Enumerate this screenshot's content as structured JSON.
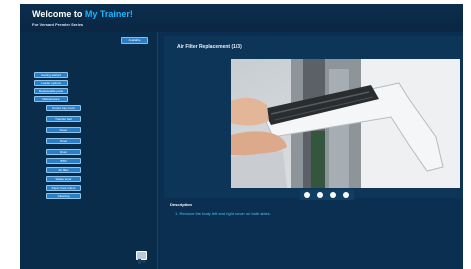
{
  "header": {
    "title_prefix": "Welcome to ",
    "title_brand": "My Trainer!",
    "subtitle": "For Versant Premier Series"
  },
  "sidebar": {
    "top_button": "Available",
    "items": [
      {
        "label": "Getting started"
      },
      {
        "label": "Loader options"
      },
      {
        "label": "Replaceable parts"
      },
      {
        "label": "Maintenance"
      }
    ],
    "subitems": [
      {
        "label": "Output tray cover"
      },
      {
        "label": "Transfer belt"
      },
      {
        "label": "Fuser"
      },
      {
        "label": "Toner"
      },
      {
        "label": "Drum"
      },
      {
        "label": "BTR"
      },
      {
        "label": "Air filter"
      },
      {
        "label": "Waste toner"
      },
      {
        "label": "Paper feed rollers"
      },
      {
        "label": "Cleaning"
      }
    ],
    "exit_icon": "exit-door-icon"
  },
  "viewer": {
    "title": "Air Filter Replacement (1/3)",
    "controls": [
      "first-icon",
      "previous-icon",
      "next-icon",
      "last-icon"
    ]
  },
  "description": {
    "label": "Description",
    "text": "1. Remove the body left and right cover on both sides."
  },
  "colors": {
    "background": "#0a2a47",
    "accent": "#1fb4ff",
    "button": "#2a80c8",
    "description_text": "#4fc2ff"
  }
}
